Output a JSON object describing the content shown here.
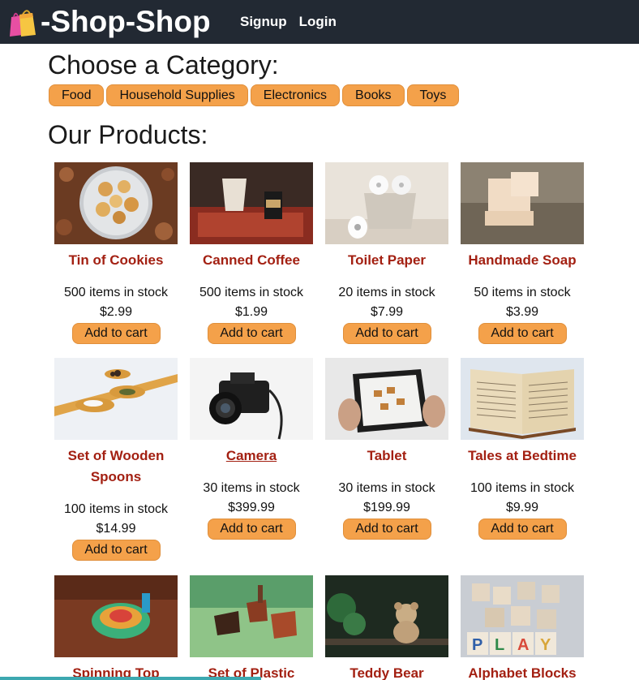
{
  "header": {
    "brand_icon": "shopping-bags-icon",
    "brand": "-Shop-Shop",
    "nav": {
      "signup": "Signup",
      "login": "Login"
    }
  },
  "categories": {
    "heading": "Choose a Category:",
    "items": [
      "Food",
      "Household Supplies",
      "Electronics",
      "Books",
      "Toys"
    ]
  },
  "products": {
    "heading": "Our Products:",
    "add_label": "Add to cart",
    "items": [
      {
        "name": "Tin of Cookies",
        "stock": "500 items in stock",
        "price": "$2.99"
      },
      {
        "name": "Canned Coffee",
        "stock": "500 items in stock",
        "price": "$1.99"
      },
      {
        "name": "Toilet Paper",
        "stock": "20 items in stock",
        "price": "$7.99"
      },
      {
        "name": "Handmade Soap",
        "stock": "50 items in stock",
        "price": "$3.99"
      },
      {
        "name": "Set of Wooden Spoons",
        "stock": "100 items in stock",
        "price": "$14.99"
      },
      {
        "name": "Camera",
        "stock": "30 items in stock",
        "price": "$399.99"
      },
      {
        "name": "Tablet",
        "stock": "30 items in stock",
        "price": "$199.99"
      },
      {
        "name": "Tales at Bedtime",
        "stock": "100 items in stock",
        "price": "$9.99"
      },
      {
        "name": "Spinning Top",
        "stock": "",
        "price": ""
      },
      {
        "name": "Set of Plastic",
        "stock": "",
        "price": ""
      },
      {
        "name": "Teddy Bear",
        "stock": "",
        "price": ""
      },
      {
        "name": "Alphabet Blocks",
        "stock": "",
        "price": ""
      }
    ]
  },
  "colors": {
    "header_bg": "#222933",
    "accent": "#f4a14a",
    "product_name": "#a32012"
  }
}
